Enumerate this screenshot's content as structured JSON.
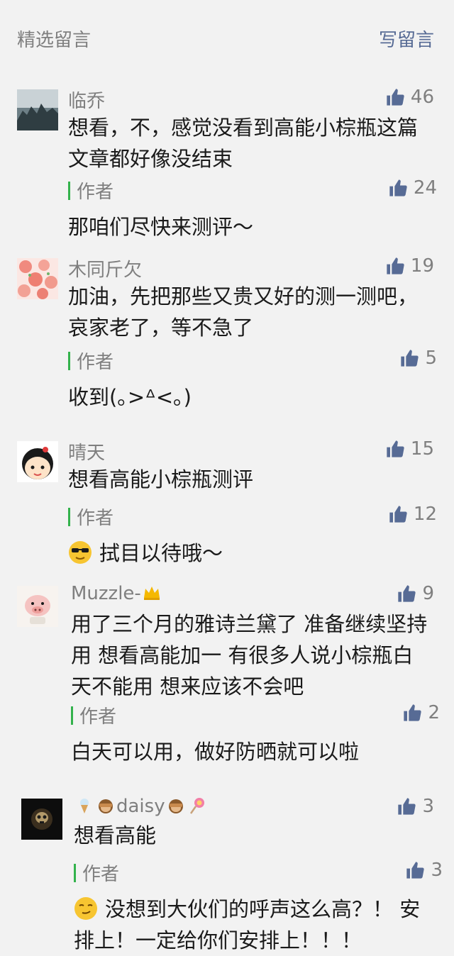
{
  "header": {
    "title": "精选留言",
    "write_label": "写留言"
  },
  "colors": {
    "accent_link": "#576b95",
    "author_bar": "#33b24c",
    "thumb": "#576b95"
  },
  "comments": [
    {
      "nickname": "临乔",
      "likes": "46",
      "text": "想看，不，感觉没看到高能小棕瓶这篇文章都好像没结束",
      "reply": {
        "author": "作者",
        "likes": "24",
        "text": "那咱们尽快来测评～"
      }
    },
    {
      "nickname": "木同斤欠",
      "likes": "19",
      "text": "加油，先把那些又贵又好的测一测吧，哀家老了，等不急了",
      "reply": {
        "author": "作者",
        "likes": "5",
        "text": "收到(｡>ᐞ<｡)"
      }
    },
    {
      "nickname": "晴天",
      "likes": "15",
      "text": "想看高能小棕瓶测评",
      "reply": {
        "author": "作者",
        "likes": "12",
        "text": "拭目以待哦～",
        "emoji": "cool-face-icon"
      }
    },
    {
      "nickname": "Muzzle-",
      "nickname_icon": "crown-icon",
      "likes": "9",
      "text": "用了三个月的雅诗兰黛了 准备继续坚持用 想看高能加一 有很多人说小棕瓶白天不能用  想来应该不会吧",
      "reply": {
        "author": "作者",
        "likes": "2",
        "text": "白天可以用，做好防晒就可以啦"
      }
    },
    {
      "nickname": "daisy",
      "nickname_icons": [
        "ice-cream-icon",
        "see-no-evil-monkey-icon",
        "see-no-evil-monkey-icon",
        "lollipop-icon"
      ],
      "likes": "3",
      "text": "想看高能",
      "reply": {
        "author": "作者",
        "likes": "3",
        "text": "没想到大伙们的呼声这么高？！ 安排上！一定给你们安排上！！！",
        "emoji": "smirk-face-icon"
      }
    }
  ]
}
